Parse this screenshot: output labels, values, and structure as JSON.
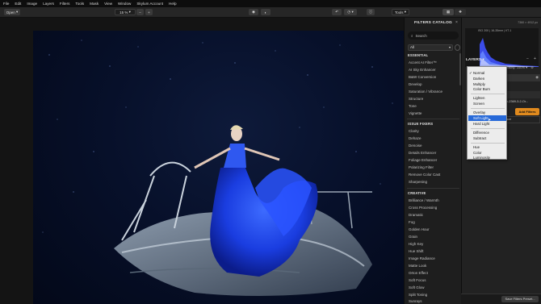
{
  "menu": [
    "File",
    "Edit",
    "Image",
    "Layers",
    "Filters",
    "Tools",
    "Mask",
    "View",
    "Window",
    "Skylum Account",
    "Help"
  ],
  "toolbar": {
    "open_label": "Open",
    "zoom_label": "15 %",
    "tools_label": "Tools"
  },
  "catalog": {
    "title": "FILTERS CATALOG",
    "search_placeholder": "Search",
    "select_value": "All",
    "sections": [
      {
        "title": "ESSENTIAL",
        "items": [
          "Accent AI Filter™",
          "AI Sky Enhancer",
          "B&W Conversion",
          "Develop",
          "Saturation / Vibrance",
          "Structure",
          "Tone",
          "Vignette"
        ]
      },
      {
        "title": "ISSUE FIXERS",
        "items": [
          "Clarity",
          "Dehaze",
          "Denoise",
          "Details Enhancer",
          "Foliage Enhancer",
          "Polarizing Filter",
          "Remove Color Cast",
          "Sharpening"
        ]
      },
      {
        "title": "CREATIVE",
        "items": [
          "Brilliance / Warmth",
          "Cross Processing",
          "Dramatic",
          "Fog",
          "Golden Hour",
          "Grain",
          "High Key",
          "Hue Shift",
          "Image Radiance",
          "Matte Look",
          "Orton Effect",
          "Soft Focus",
          "Soft Glow",
          "Split Toning",
          "Sunrays"
        ]
      }
    ]
  },
  "histogram": {
    "info": "ISO 200 | 16-35mm | f/7.1",
    "dims": "7360 × 4912 px"
  },
  "layers": {
    "title": "LAYERS",
    "opacity_label": "Opacity:",
    "opacity_value": "100%",
    "blend_value": "Normal",
    "layer_name": "b-2369-3-2-Or...",
    "add_filters": "Add Filters",
    "face_label": "ace"
  },
  "blend_menu": {
    "groups": [
      [
        "Normal",
        "Darken",
        "Multiply",
        "Color Burn"
      ],
      [
        "Lighten",
        "Screen"
      ],
      [
        "Overlay",
        "Soft Light",
        "Hard Light"
      ],
      [
        "Difference",
        "Subtract"
      ],
      [
        "Hue",
        "Color",
        "Luminosity"
      ]
    ],
    "checked": "Normal",
    "highlighted": "Soft Light"
  },
  "bottom": {
    "save_preset": "Save Filters Preset..."
  },
  "colors": {
    "accent": "#e08a1e",
    "highlight": "#2769d8",
    "dress": "#1a3de0"
  }
}
